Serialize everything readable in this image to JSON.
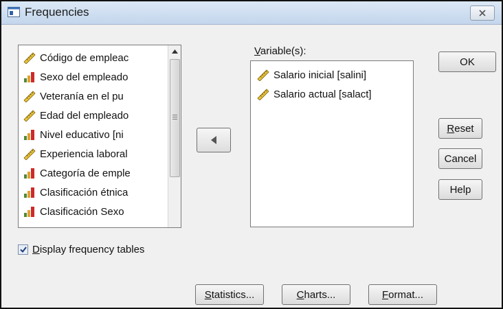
{
  "window": {
    "title": "Frequencies",
    "close_label": "✕"
  },
  "source_list": {
    "items": [
      {
        "label": "Código de empleac",
        "icon": "scale-ruler-icon"
      },
      {
        "label": "Sexo del empleado",
        "icon": "nominal-bars-icon"
      },
      {
        "label": "Veteranía en el pu",
        "icon": "scale-ruler-icon"
      },
      {
        "label": "Edad del empleado",
        "icon": "scale-ruler-icon"
      },
      {
        "label": "Nivel educativo [ni",
        "icon": "nominal-bars-icon"
      },
      {
        "label": "Experiencia laboral",
        "icon": "scale-ruler-icon"
      },
      {
        "label": "Categoría de emple",
        "icon": "nominal-bars-icon"
      },
      {
        "label": "Clasificación étnica",
        "icon": "nominal-bars-icon"
      },
      {
        "label": "Clasificación Sexo",
        "icon": "nominal-bars-icon"
      }
    ]
  },
  "target": {
    "label": "Variable(s):",
    "items": [
      {
        "label": "Salario inicial [salini]",
        "icon": "scale-ruler-icon"
      },
      {
        "label": "Salario actual [salact]",
        "icon": "scale-ruler-icon"
      }
    ]
  },
  "buttons": {
    "ok": "OK",
    "reset": "Reset",
    "cancel": "Cancel",
    "help": "Help",
    "statistics": "Statistics...",
    "charts": "Charts...",
    "format": "Format..."
  },
  "options": {
    "display_frequency_tables": {
      "label": "Display frequency tables",
      "checked": true
    }
  },
  "colors": {
    "titlebar": "#c4d6ec",
    "ruler": "#e8c23a",
    "bar_red": "#cc2a2a"
  }
}
